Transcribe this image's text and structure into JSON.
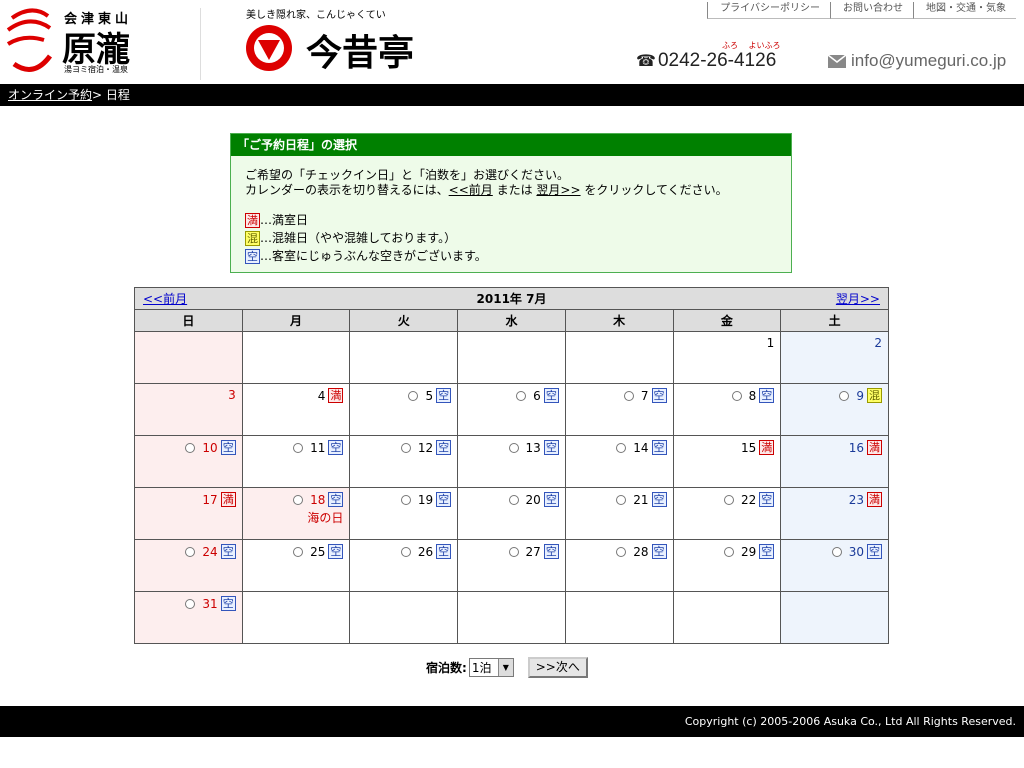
{
  "header": {
    "logo1_text": "原瀧",
    "logo1_small": "会津東山",
    "logo1_sub": "湯ヨミ宿泊・温泉",
    "tagline": "美しき隠れ家、こんじゃくてい",
    "logo2_text": "今昔亭",
    "topnav": [
      "プライバシーポリシー",
      "お問い合わせ",
      "地図・交通・気象"
    ],
    "phone": "0242-26-4126",
    "phone_ruby": "ふろ　 よいふろ",
    "email": "info@yumeguri.co.jp"
  },
  "breadcrumb": {
    "link": "オンライン予約",
    "separator": "> ",
    "current": "日程"
  },
  "info": {
    "title": "「ご予約日程」の選択",
    "line1": "ご希望の「チェックイン日」と「泊数を」お選びください。",
    "line2_a": "カレンダーの表示を切り替えるには、",
    "line2_prev": "<<前月",
    "line2_b": " または ",
    "line2_next": "翌月>>",
    "line2_c": " をクリックしてください。",
    "legend": [
      {
        "badge": "満",
        "type": "full",
        "text": "…満室日"
      },
      {
        "badge": "混",
        "type": "busy",
        "text": "…混雑日（やや混雑しております。）"
      },
      {
        "badge": "空",
        "type": "free",
        "text": "…客室にじゅうぶんな空きがございます。"
      }
    ]
  },
  "calendar": {
    "prev": "<<前月",
    "next": "翌月>>",
    "title": "2011年 7月",
    "weekdays": [
      "日",
      "月",
      "火",
      "水",
      "木",
      "金",
      "土"
    ],
    "weeks": [
      [
        null,
        null,
        null,
        null,
        null,
        {
          "d": "1"
        },
        {
          "d": "2"
        }
      ],
      [
        {
          "d": "3"
        },
        {
          "d": "4",
          "s": "full"
        },
        {
          "d": "5",
          "s": "free",
          "r": true
        },
        {
          "d": "6",
          "s": "free",
          "r": true
        },
        {
          "d": "7",
          "s": "free",
          "r": true
        },
        {
          "d": "8",
          "s": "free",
          "r": true
        },
        {
          "d": "9",
          "s": "busy",
          "r": true
        }
      ],
      [
        {
          "d": "10",
          "s": "free",
          "r": true
        },
        {
          "d": "11",
          "s": "free",
          "r": true
        },
        {
          "d": "12",
          "s": "free",
          "r": true
        },
        {
          "d": "13",
          "s": "free",
          "r": true
        },
        {
          "d": "14",
          "s": "free",
          "r": true
        },
        {
          "d": "15",
          "s": "full"
        },
        {
          "d": "16",
          "s": "full"
        }
      ],
      [
        {
          "d": "17",
          "s": "full"
        },
        {
          "d": "18",
          "s": "free",
          "r": true,
          "h": "海の日"
        },
        {
          "d": "19",
          "s": "free",
          "r": true
        },
        {
          "d": "20",
          "s": "free",
          "r": true
        },
        {
          "d": "21",
          "s": "free",
          "r": true
        },
        {
          "d": "22",
          "s": "free",
          "r": true
        },
        {
          "d": "23",
          "s": "full"
        }
      ],
      [
        {
          "d": "24",
          "s": "free",
          "r": true
        },
        {
          "d": "25",
          "s": "free",
          "r": true
        },
        {
          "d": "26",
          "s": "free",
          "r": true
        },
        {
          "d": "27",
          "s": "free",
          "r": true
        },
        {
          "d": "28",
          "s": "free",
          "r": true
        },
        {
          "d": "29",
          "s": "free",
          "r": true
        },
        {
          "d": "30",
          "s": "free",
          "r": true
        }
      ],
      [
        {
          "d": "31",
          "s": "free",
          "r": true
        },
        null,
        null,
        null,
        null,
        null,
        null
      ]
    ],
    "badges": {
      "full": "満",
      "busy": "混",
      "free": "空"
    }
  },
  "controls": {
    "nights_label": "宿泊数:",
    "nights_value": "1泊",
    "next_button": ">>次へ"
  },
  "footer": {
    "copyright": "Copyright (c) 2005-2006 Asuka Co., Ltd All Rights Reserved."
  },
  "colors": {
    "accent_green": "#008000",
    "full_red": "#cc0000",
    "free_blue": "#2244aa",
    "busy_yellow": "#ffff66"
  }
}
